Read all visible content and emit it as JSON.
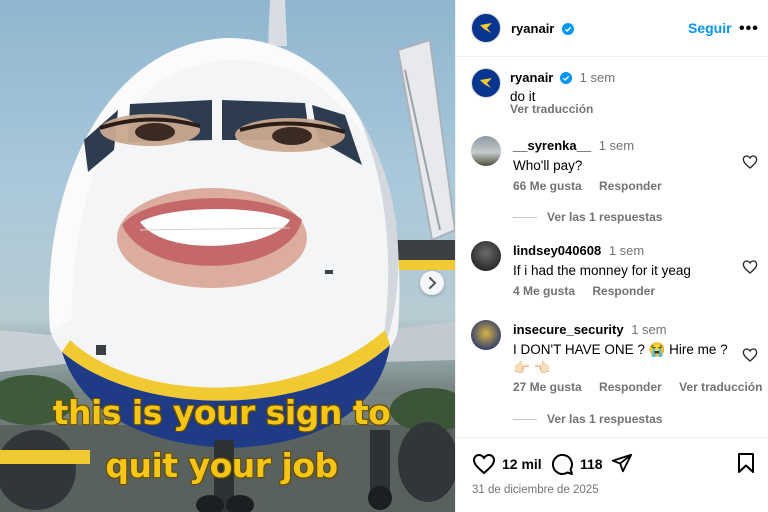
{
  "post": {
    "caption_overlay_line1": "this is your sign to",
    "caption_overlay_line2": "quit your job"
  },
  "header": {
    "username": "ryanair",
    "follow_label": "Seguir",
    "more_label": "•••"
  },
  "caption": {
    "username": "ryanair",
    "time": "1 sem",
    "text": "do it",
    "translate_label": "Ver traducción"
  },
  "comments": [
    {
      "username": "__syrenka__",
      "time": "1 sem",
      "text": "Who'll pay?",
      "likes": "66 Me gusta",
      "reply_label": "Responder",
      "replies_label": "Ver las 1 respuestas"
    },
    {
      "username": "lindsey040608",
      "time": "1 sem",
      "text": "If i had the monney for it yeag",
      "likes": "4 Me gusta",
      "reply_label": "Responder"
    },
    {
      "username": "insecure_security",
      "time": "1 sem",
      "text": "I DON'T HAVE ONE ? 😭 Hire me ? 👉🏻 👈🏻",
      "likes": "27 Me gusta",
      "reply_label": "Responder",
      "translate_label": "Ver traducción",
      "replies_label": "Ver las 1 respuestas"
    }
  ],
  "actions": {
    "likes_count": "12 mil",
    "comments_count": "118",
    "date": "31 de diciembre de 2025"
  },
  "icons": {
    "verified": "verified-badge-icon",
    "heart": "heart-icon",
    "comment": "comment-icon",
    "share": "share-icon",
    "save": "bookmark-icon",
    "next": "chevron-right-icon"
  },
  "colors": {
    "accent": "#0095f6",
    "verified": "#0095f6",
    "brand_navy": "#073590",
    "brand_gold": "#f1c933",
    "caption_yellow": "#f5c518"
  }
}
